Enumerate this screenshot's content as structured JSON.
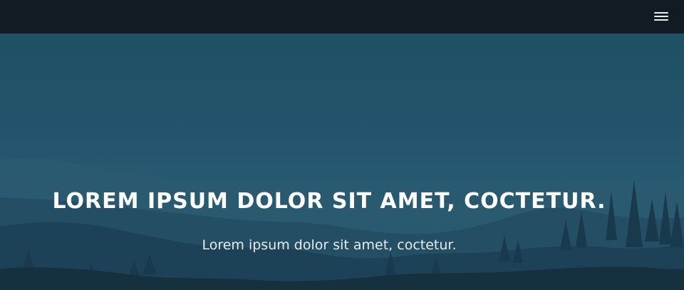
{
  "navbar": {
    "menu_icon": "hamburger-menu-icon"
  },
  "hero": {
    "title": "LOREM IPSUM DOLOR SIT AMET, COCTETUR.",
    "subtitle": "Lorem ipsum dolor sit amet, coctetur.",
    "background_image": "misty-mountains-forest-illustration"
  },
  "colors": {
    "navbar_bg": "#111b24",
    "sky_top": "#1f5064",
    "mountain_far": "#2b5a70",
    "mountain_near": "#1f4358",
    "forest": "#163447",
    "text": "#ffffff"
  }
}
